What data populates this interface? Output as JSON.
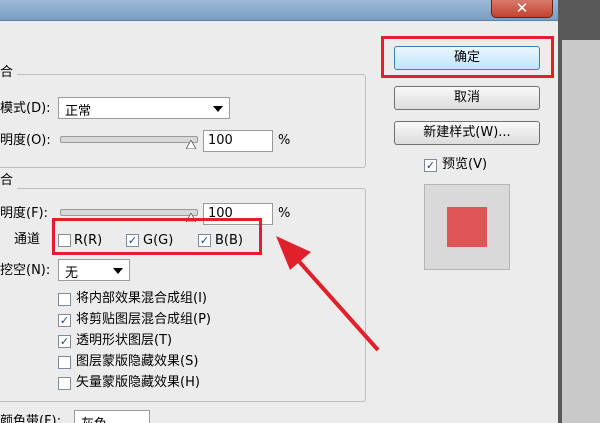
{
  "close_label": "✕",
  "section1": {
    "title": "合",
    "mode_label": "模式(D):",
    "mode_value": "正常",
    "opacity_label": "明度(O):",
    "opacity_value": "100",
    "percent": "%"
  },
  "section2": {
    "title": "合",
    "fill_label": "明度(F):",
    "fill_value": "100",
    "percent": "%",
    "channels_label": "通道",
    "channel_r": "R(R)",
    "channel_g": "G(G)",
    "channel_b": "B(B)",
    "knockout_label": "挖空(N):",
    "knockout_value": "无",
    "options": [
      {
        "label": "将内部效果混合成组(I)",
        "checked": false
      },
      {
        "label": "将剪贴图层混合成组(P)",
        "checked": true
      },
      {
        "label": "透明形状图层(T)",
        "checked": true
      },
      {
        "label": "图层蒙版隐藏效果(S)",
        "checked": false
      },
      {
        "label": "矢量蒙版隐藏效果(H)",
        "checked": false
      }
    ],
    "bottom_label": "颜色带(F):",
    "bottom_value": "灰色"
  },
  "buttons": {
    "ok": "确定",
    "cancel": "取消",
    "new_style": "新建样式(W)...",
    "preview": "预览(V)"
  },
  "channels_checked": {
    "r": false,
    "g": true,
    "b": true
  },
  "colors": {
    "swatch": "#e05555",
    "highlight": "#e0202a",
    "checkmark": "#1d3b9e"
  }
}
